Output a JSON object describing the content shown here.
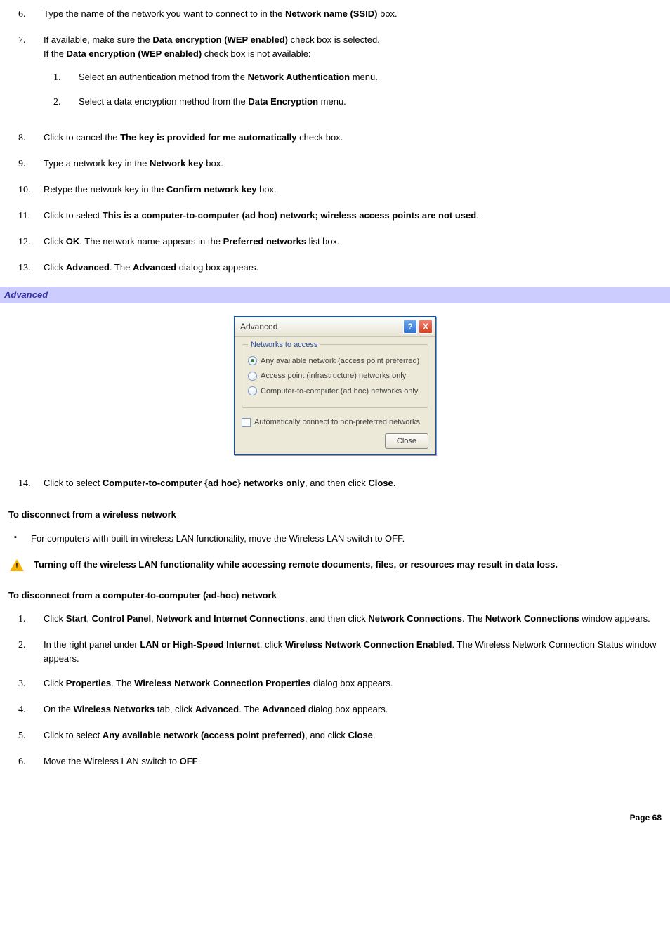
{
  "steps_a": [
    {
      "n": "6.",
      "html": "Type the name of the network you want to connect to in the <b>Network name (SSID)</b> box."
    },
    {
      "n": "7.",
      "html": "If available, make sure the <b>Data encryption (WEP enabled)</b> check box is selected.<br>If the <b>Data encryption (WEP enabled)</b> check box is not available:",
      "sub": [
        {
          "n": "1.",
          "html": "Select an authentication method from the <b>Network Authentication</b> menu."
        },
        {
          "n": "2.",
          "html": "Select a data encryption method from the <b>Data Encryption</b> menu."
        }
      ]
    },
    {
      "n": "8.",
      "html": "Click to cancel the <b>The key is provided for me automatically</b> check box."
    },
    {
      "n": "9.",
      "html": "Type a network key in the <b>Network key</b> box."
    },
    {
      "n": "10.",
      "html": "Retype the network key in the <b>Confirm network key</b> box."
    },
    {
      "n": "11.",
      "html": "Click to select <b>This is a computer-to-computer (ad hoc) network; wireless access points are not used</b>."
    },
    {
      "n": "12.",
      "html": "Click <b>OK</b>. The network name appears in the <b>Preferred networks</b> list box."
    },
    {
      "n": "13.",
      "html": "Click <b>Advanced</b>. The <b>Advanced</b> dialog box appears."
    }
  ],
  "banner": "Advanced",
  "dialog": {
    "title": "Advanced",
    "help": "?",
    "close_x": "X",
    "group_title": "Networks to access",
    "radios": [
      {
        "label": "Any available network (access point preferred)",
        "selected": true
      },
      {
        "label": "Access point (infrastructure) networks only",
        "selected": false
      },
      {
        "label": "Computer-to-computer (ad hoc) networks only",
        "selected": false
      }
    ],
    "checkbox_label": "Automatically connect to non-preferred networks",
    "close_btn": "Close"
  },
  "step14": {
    "n": "14.",
    "html": "Click to select <b>Computer-to-computer {ad hoc} networks only</b>, and then click <b>Close</b>."
  },
  "subhead1": "To disconnect from a wireless network",
  "bullet1": "For computers with built-in wireless LAN functionality, move the Wireless LAN switch to OFF.",
  "warning": "Turning off the wireless LAN functionality while accessing remote documents, files, or resources may result in data loss.",
  "subhead2": "To disconnect from a computer-to-computer (ad-hoc) network",
  "steps_b": [
    {
      "n": "1.",
      "html": "Click <b>Start</b>, <b>Control Panel</b>, <b>Network and Internet Connections</b>, and then click <b>Network Connections</b>. The <b>Network Connections</b> window appears."
    },
    {
      "n": "2.",
      "html": "In the right panel under <b>LAN or High-Speed Internet</b>, click <b>Wireless Network Connection Enabled</b>. The Wireless Network Connection Status window appears."
    },
    {
      "n": "3.",
      "html": "Click <b>Properties</b>. The <b>Wireless Network Connection Properties</b> dialog box appears."
    },
    {
      "n": "4.",
      "html": "On the <b>Wireless Networks</b> tab, click <b>Advanced</b>. The <b>Advanced</b> dialog box appears."
    },
    {
      "n": "5.",
      "html": "Click to select <b>Any available network (access point preferred)</b>, and click <b>Close</b>."
    },
    {
      "n": "6.",
      "html": "Move the Wireless LAN switch to <b>OFF</b>."
    }
  ],
  "page_footer": "Page 68"
}
